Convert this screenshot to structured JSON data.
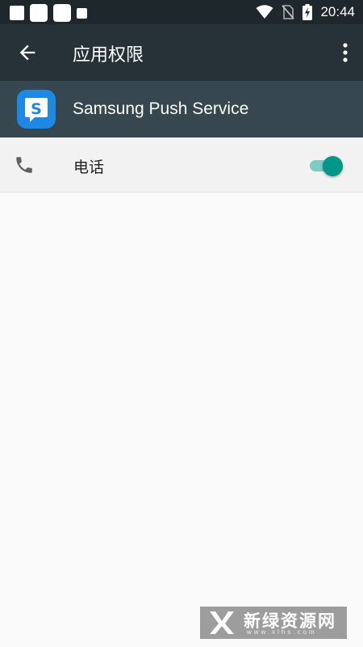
{
  "status_bar": {
    "time": "20:44",
    "icons": [
      "notification-square-icon",
      "notification-square-icon",
      "notification-square-icon",
      "notification-square-icon",
      "wifi-icon",
      "no-sim-icon",
      "battery-charging-icon"
    ]
  },
  "app_bar": {
    "back_icon": "arrow-left-icon",
    "title": "应用权限",
    "more_icon": "more-vert-icon"
  },
  "app_header": {
    "app_name": "Samsung Push Service",
    "icon_letter": "S",
    "icon_color": "#1e88e5"
  },
  "permissions": [
    {
      "icon": "phone-icon",
      "label": "电话",
      "enabled": true
    }
  ],
  "watermark": {
    "text": "新绿资源网",
    "url": "www.xlhs.com"
  },
  "colors": {
    "status_bar_bg": "#1e272c",
    "app_bar_bg": "#263238",
    "header_bg": "#37474f",
    "toggle_on": "#009688",
    "toggle_track": "#80cbc4"
  }
}
